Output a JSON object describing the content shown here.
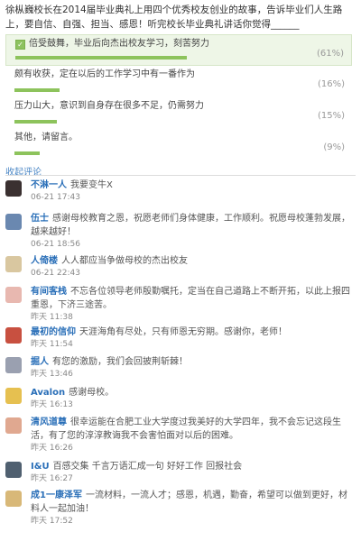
{
  "question": "徐枞巍校长在2014届毕业典礼上用四个优秀校友创业的故事，告诉毕业们人生路上，要自信、自强、担当、感恩！听完校长毕业典礼讲话你觉得______",
  "poll": {
    "options": [
      {
        "label": "倍受鼓舞，毕业后向杰出校友学习，刻苦努力",
        "percent_text": "(61%)",
        "percent": 61,
        "selected": true
      },
      {
        "label": "颇有收获，定在以后的工作学习中有一番作为",
        "percent_text": "(16%)",
        "percent": 16,
        "selected": false
      },
      {
        "label": "压力山大，意识到自身存在很多不足，仍需努力",
        "percent_text": "(15%)",
        "percent": 15,
        "selected": false
      },
      {
        "label": "其他，请留言。",
        "percent_text": "(9%)",
        "percent": 9,
        "selected": false
      }
    ]
  },
  "comments_title": "收起评论",
  "comments": [
    {
      "name": "不淋一人",
      "text": "我要变牛X",
      "time": "06-21 17:43",
      "avatar_color": "#3a3030"
    },
    {
      "name": "伍士",
      "text": "感谢母校教育之恩，祝愿老师们身体健康，工作顺利。祝愿母校蓬勃发展，越来越好！",
      "time": "06-21 18:56",
      "avatar_color": "#6a88b0"
    },
    {
      "name": "人倚楼",
      "text": "人人都应当争做母校的杰出校友",
      "time": "06-21 22:43",
      "avatar_color": "#d9c7a0"
    },
    {
      "name": "有间客栈",
      "text": "不忘各位领导老师殷勤嘱托，定当在自己道路上不断开拓，以此上报四重恩，下济三途苦。",
      "time": "昨天 11:38",
      "avatar_color": "#e8b8b0"
    },
    {
      "name": "最初的信仰",
      "text": "天涯海角有尽处，只有师恩无穷期。感谢你，老师！",
      "time": "昨天 11:54",
      "avatar_color": "#c85040"
    },
    {
      "name": "掘人",
      "text": "有您的激励，我们会回披荆斩棘！",
      "time": "昨天 13:46",
      "avatar_color": "#9aa0b0"
    },
    {
      "name": "Avalon",
      "text": "感谢母校。",
      "time": "昨天 16:13",
      "avatar_color": "#e6c050"
    },
    {
      "name": "清风道尊",
      "text": "很幸运能在合肥工业大学度过我美好的大学四年，我不会忘记这段生活，有了您的淳淳教诲我不会害怕面对以后的困难。",
      "time": "昨天 16:26",
      "avatar_color": "#e0a890"
    },
    {
      "name": "I&U",
      "text": "百感交集 千言万语汇成一句 好好工作 回报社会",
      "time": "昨天 16:27",
      "avatar_color": "#506070"
    },
    {
      "name": "成1一康泽军",
      "text": "一流材料，一流人才；感恩，机遇，勤奋，希望可以做到更好，材料人一起加油！",
      "time": "昨天 17:52",
      "avatar_color": "#d8b878"
    }
  ]
}
